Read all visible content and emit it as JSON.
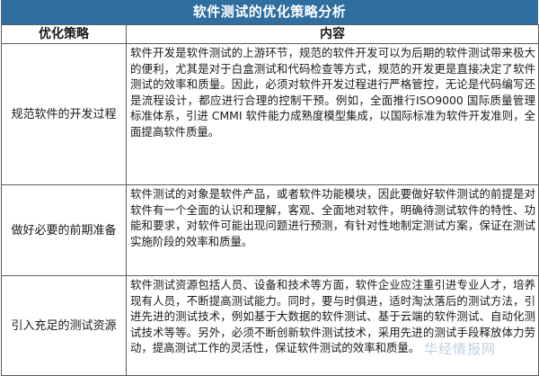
{
  "title": "软件测试的优化策略分析",
  "headers": {
    "strategy": "优化策略",
    "content": "内容"
  },
  "rows": [
    {
      "strategy": "规范软件的开发过程",
      "content": "软件开发是软件测试的上游环节，规范的软件开发可以为后期的软件测试带来极大的便利，尤其是对于白盒测试和代码检查等方式，规范的开发更是直接决定了软件测试的效率和质量。因此，必须对软件开发过程进行严格管控，无论是代码编写还是流程设计，都应进行合理的控制干预。例如，全面推行ISO9000 国际质量管理标准体系，引进 CMMI 软件能力成熟度模型集成，以国际标准为软件开发准则，全面提高软件质量。"
    },
    {
      "strategy": "做好必要的前期准备",
      "content": "软件测试的对象是软件产品，或者软件功能模块，因此要做好软件测试的前提是对软件有一个全面的认识和理解，客观、全面地对软件，明确待测试软件的特性、功能和要求，对软件可能出现问题进行预测，有针对性地制定测试方案，保证在测试实施阶段的效率和质量。"
    },
    {
      "strategy": "引入充足的测试资源",
      "content": "软件测试资源包括人员、设备和技术等方面，软件企业应注重引进专业人才，培养现有人员，不断提高测试能力。同时，要与时俱进，适时淘汰落后的测试方法，引进先进的测试技术，例如基于大数据的软件测试、基于云端的软件测试、自动化测试技术等等。另外，必须不断创新软件测试技术，采用先进的测试手段释放体力劳动，提高测试工作的灵活性，保证软件测试的效率和质量。"
    }
  ],
  "watermark": "华经情报网"
}
